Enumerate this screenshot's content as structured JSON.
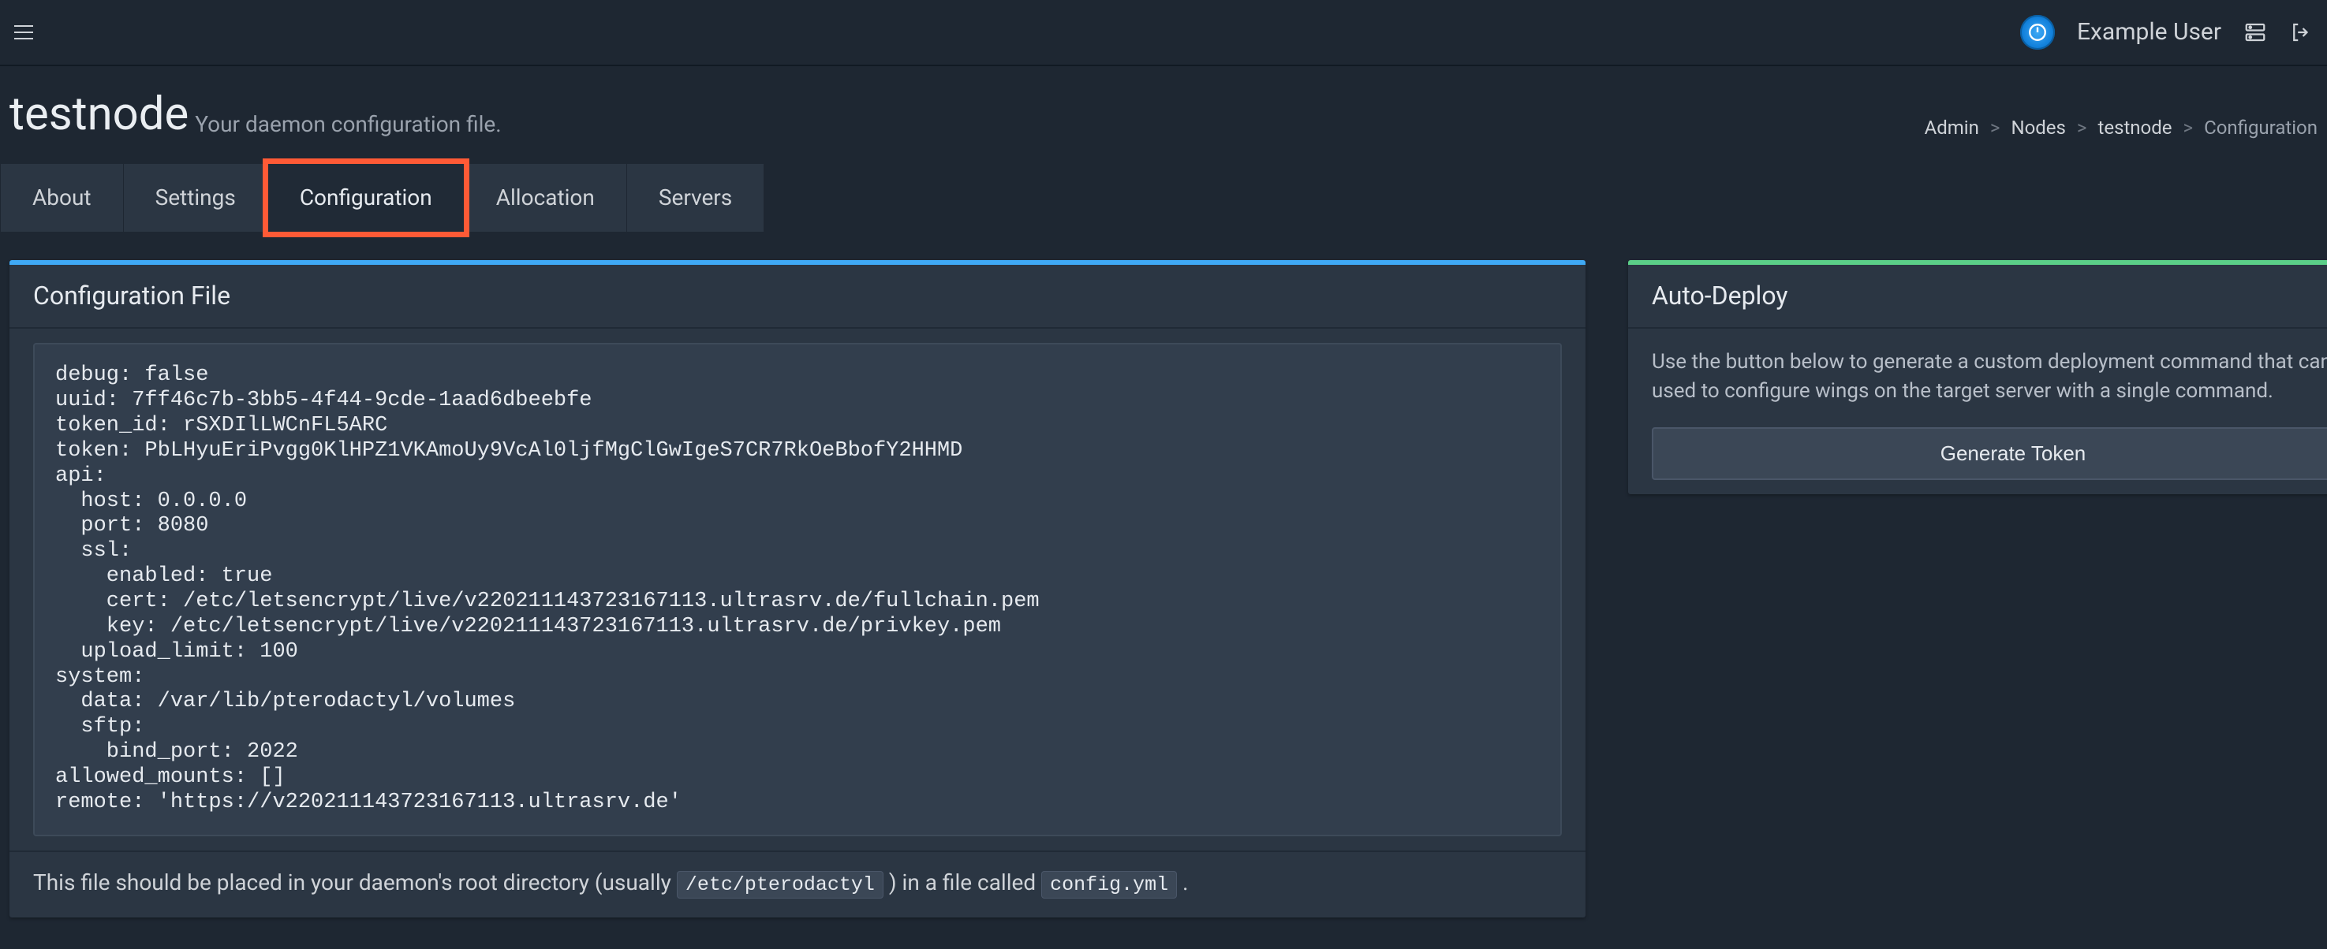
{
  "topbar": {
    "username": "Example User"
  },
  "header": {
    "title": "testnode",
    "subtitle": "Your daemon configuration file."
  },
  "breadcrumb": {
    "admin": "Admin",
    "nodes": "Nodes",
    "node": "testnode",
    "current": "Configuration"
  },
  "tabs": {
    "about": "About",
    "settings": "Settings",
    "configuration": "Configuration",
    "allocation": "Allocation",
    "servers": "Servers",
    "active": "configuration"
  },
  "config_panel": {
    "title": "Configuration File",
    "config_yaml": "debug: false\nuuid: 7ff46c7b-3bb5-4f44-9cde-1aad6dbeebfe\ntoken_id: rSXDIlLWCnFL5ARC\ntoken: PbLHyuEriPvgg0KlHPZ1VKAmoUy9VcAl0ljfMgClGwIgeS7CR7RkOeBbofY2HHMD\napi:\n  host: 0.0.0.0\n  port: 8080\n  ssl:\n    enabled: true\n    cert: /etc/letsencrypt/live/v220211143723167113.ultrasrv.de/fullchain.pem\n    key: /etc/letsencrypt/live/v220211143723167113.ultrasrv.de/privkey.pem\n  upload_limit: 100\nsystem:\n  data: /var/lib/pterodactyl/volumes\n  sftp:\n    bind_port: 2022\nallowed_mounts: []\nremote: 'https://v220211143723167113.ultrasrv.de'",
    "footer_pre": "This file should be placed in your daemon's root directory (usually ",
    "footer_code1": "/etc/pterodactyl",
    "footer_mid": " ) in a file called ",
    "footer_code2": "config.yml",
    "footer_post": " ."
  },
  "autodeploy": {
    "title": "Auto-Deploy",
    "description": "Use the button below to generate a custom deployment command that can be used to configure wings on the target server with a single command.",
    "button": "Generate Token"
  }
}
